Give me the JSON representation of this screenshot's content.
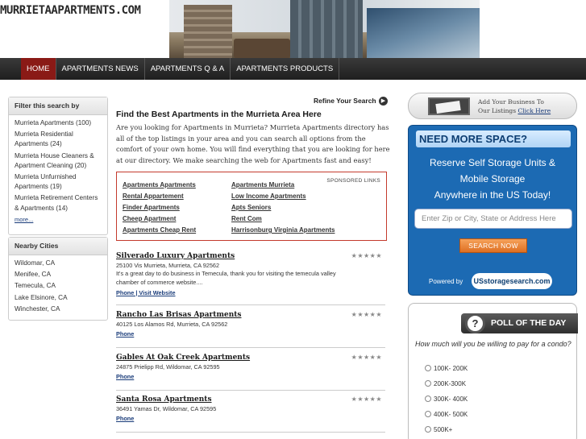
{
  "header": {
    "logo": "MURRIETAAPARTMENTS.COM"
  },
  "nav": [
    "HOME",
    "APARTMENTS NEWS",
    "APARTMENTS Q & A",
    "APARTMENTS PRODUCTS"
  ],
  "filter": {
    "title": "Filter this search by",
    "items": [
      "Murrieta Apartments (100)",
      "Murrieta Residential Apartments (24)",
      "Murrieta House Cleaners & Apartment Cleaning (20)",
      "Murrieta Unfurnished Apartments (19)",
      "Murrieta Retirement Centers & Apartments (14)"
    ],
    "more": "more..."
  },
  "nearby": {
    "title": "Nearby Cities",
    "items": [
      "Wildomar, CA",
      "Menifee, CA",
      "Temecula, CA",
      "Lake Elsinore, CA",
      "Winchester, CA"
    ]
  },
  "main": {
    "refine": "Refine Your Search",
    "title": "Find the Best Apartments in the Murrieta Area Here",
    "intro": "Are you looking for Apartments in Murrieta? Murrieta Apartments directory has all of the top listings in your area and you can search all options from the comfort of your own home. You will find everything that you are looking for here at our directory. We make searching the web for Apartments fast and easy!"
  },
  "sponsored": {
    "tag": "SPONSORED LINKS",
    "col1": [
      "Apartments Apartments",
      "Rental Appartement",
      "Finder Apartments",
      "Cheep Apartment",
      "Apartments Cheap Rent"
    ],
    "col2": [
      "Apartments Murrieta",
      "Low Income Apartments",
      "Apts Seniors",
      "Rent Com",
      "Harrisonburg Virginia Apartments"
    ]
  },
  "listings": [
    {
      "name": "Silverado Luxury Apartments",
      "address": "25100 Vis Murrieta, Murrieta, CA 92562",
      "desc": "It's a great day to do business in Temecula, thank you for visiting the temecula valley chamber of commerce website....",
      "links": "Phone | Visit Website",
      "rating": 0
    },
    {
      "name": "Rancho Las Brisas Apartments",
      "address": "40125 Los Alamos Rd, Murrieta, CA 92562",
      "desc": "",
      "links": "Phone",
      "rating": 0
    },
    {
      "name": "Gables At Oak Creek Apartments",
      "address": "24875 Prielipp Rd, Wildomar, CA 92595",
      "desc": "",
      "links": "Phone",
      "rating": 0
    },
    {
      "name": "Santa Rosa Apartments",
      "address": "36491 Yamas Dr, Wildomar, CA 92595",
      "desc": "",
      "links": "Phone",
      "rating": 0
    }
  ],
  "addbiz": {
    "line1": "Add Your Business To",
    "line2": "Our Listings",
    "link": "Click Here"
  },
  "storage": {
    "heading": "NEED MORE SPACE?",
    "line1": "Reserve Self Storage Units &",
    "line2": "Mobile Storage",
    "line3": "Anywhere in the US Today!",
    "placeholder": "Enter Zip or City, State or Address Here",
    "button": "SEARCH NOW",
    "powered": "Powered by",
    "brand": "USstoragesearch.com"
  },
  "poll": {
    "heading": "POLL OF THE DAY",
    "question": "How much will you be willing to pay for a condo?",
    "options": [
      "100K- 200K",
      "200K-300K",
      "300K- 400K",
      "400K- 500K",
      "500K+"
    ]
  }
}
